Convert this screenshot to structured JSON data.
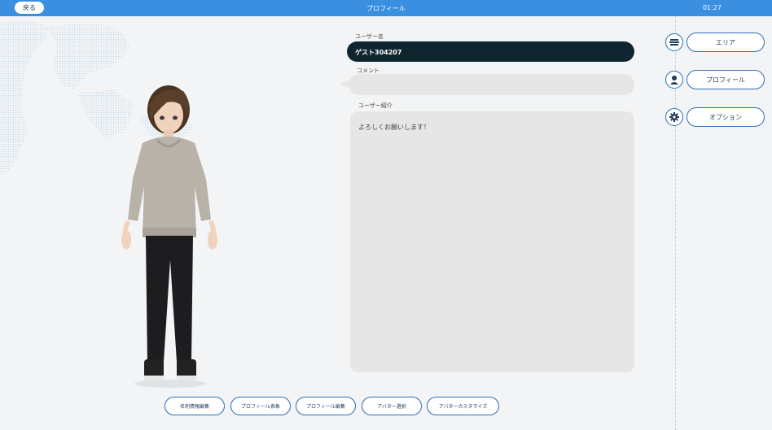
{
  "header": {
    "back_label": "戻る",
    "title": "プロフィール",
    "time": "01:27"
  },
  "profile": {
    "username_label": "ユーザー名",
    "username": "ゲスト304207",
    "comment_label": "コメント",
    "comment": "",
    "bio_label": "ユーザー紹介",
    "bio": "よろしくお願いします！"
  },
  "side_menu": [
    {
      "label": "エリア",
      "icon": "area-icon"
    },
    {
      "label": "プロフィール",
      "icon": "profile-icon"
    },
    {
      "label": "オプション",
      "icon": "gear-icon"
    }
  ],
  "bottom_buttons": [
    "名刺情報編集",
    "プロフィール表象",
    "プロフィール編集",
    "アバター選択",
    "アバターカスタマイズ"
  ],
  "colors": {
    "accent": "#3a8fe0",
    "username_bg": "#0f2530",
    "field_bg": "#e6e6e6",
    "button_border": "#2a6fb5"
  }
}
